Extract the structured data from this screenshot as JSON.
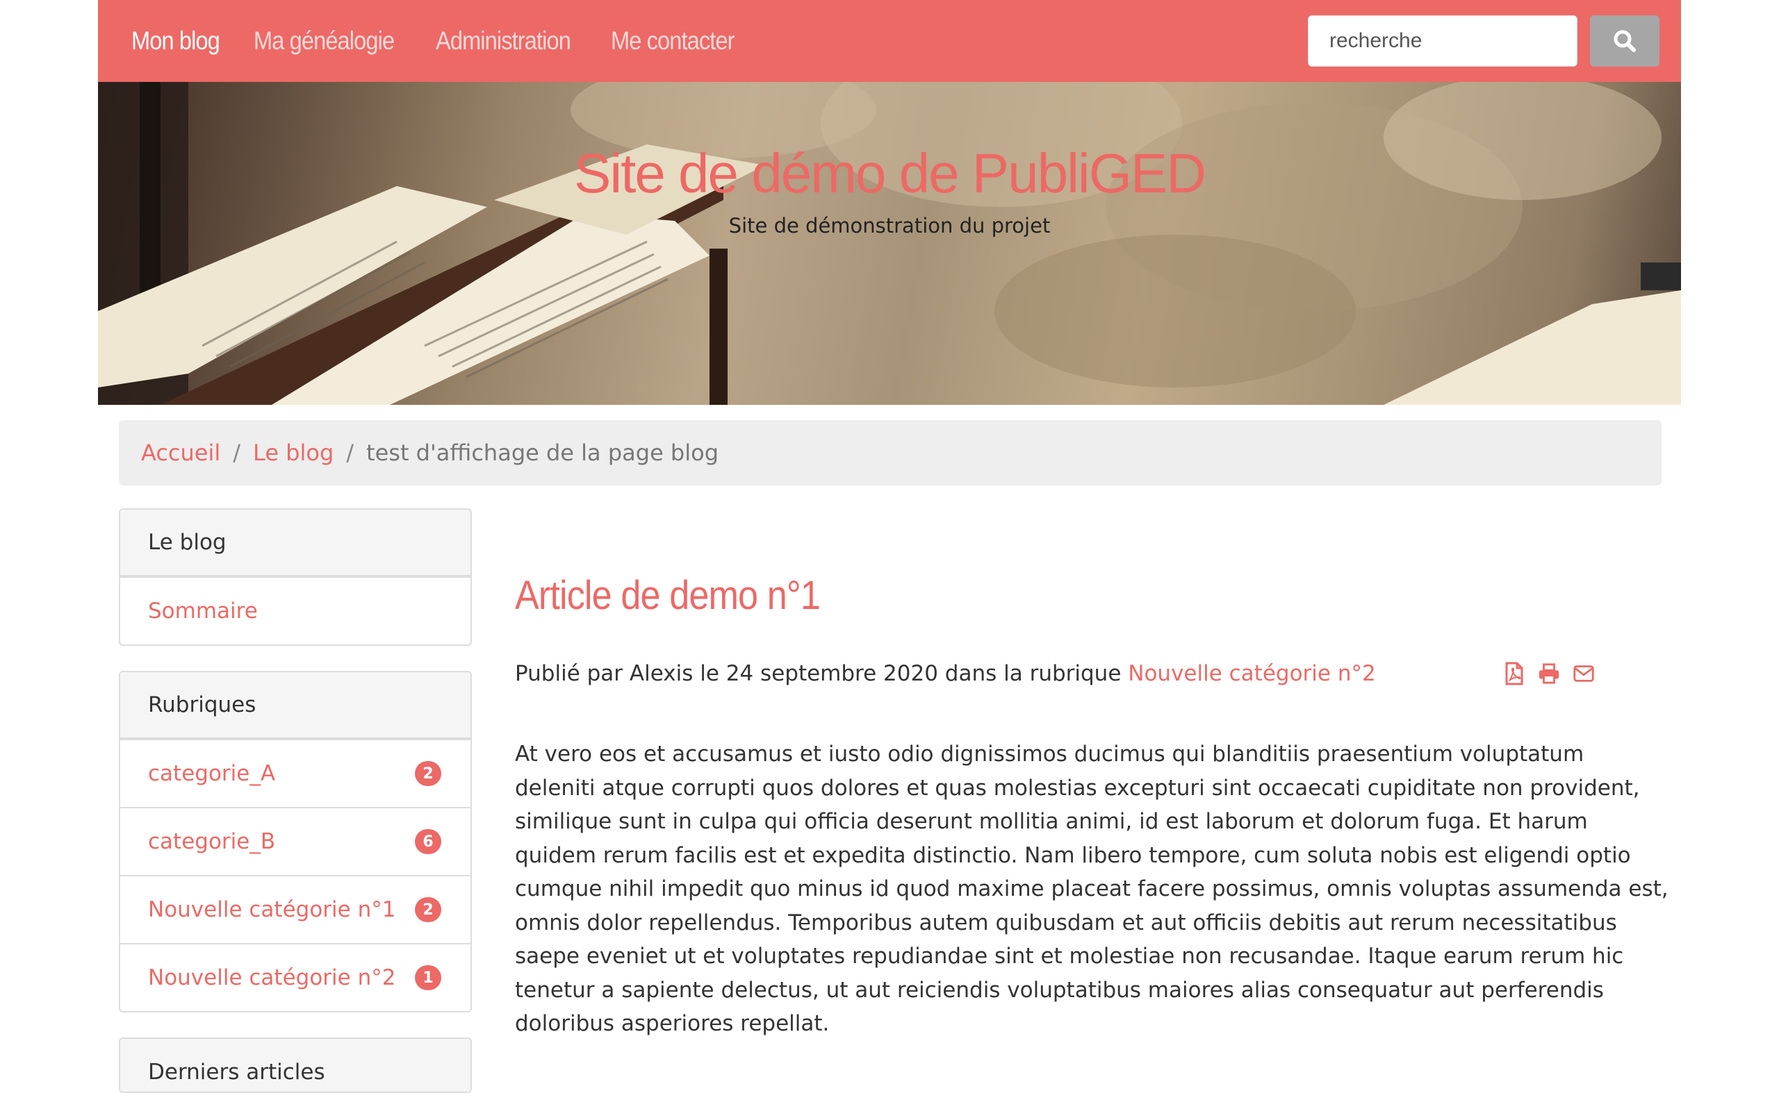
{
  "nav": {
    "items": [
      "Mon blog",
      "Ma généalogie",
      "Administration",
      "Me contacter"
    ],
    "search_placeholder": "recherche"
  },
  "hero": {
    "title": "Site de démo de PubliGED",
    "subtitle": "Site de démonstration du projet"
  },
  "breadcrumb": {
    "home": "Accueil",
    "blog": "Le blog",
    "current": "test d'affichage de la page blog",
    "separator": "/"
  },
  "sidebar": {
    "blog_panel": {
      "title": "Le blog",
      "items": [
        "Sommaire"
      ]
    },
    "categories_panel": {
      "title": "Rubriques",
      "items": [
        {
          "label": "categorie_A",
          "count": "2"
        },
        {
          "label": "categorie_B",
          "count": "6"
        },
        {
          "label": "Nouvelle catégorie n°1",
          "count": "2"
        },
        {
          "label": "Nouvelle catégorie n°2",
          "count": "1"
        }
      ]
    },
    "last_panel": {
      "title": "Derniers articles"
    }
  },
  "article": {
    "title": "Article de demo n°1",
    "meta_prefix": "Publié par Alexis le 24 septembre 2020 dans la rubrique ",
    "meta_category": "Nouvelle catégorie n°2",
    "body": "At vero eos et accusamus et iusto odio dignissimos ducimus qui blanditiis praesentium voluptatum deleniti atque corrupti quos dolores et quas molestias excepturi sint occaecati cupiditate non provident, similique sunt in culpa qui officia deserunt mollitia animi, id est laborum et dolorum fuga. Et harum quidem rerum facilis est et expedita distinctio. Nam libero tempore, cum soluta nobis est eligendi optio cumque nihil impedit quo minus id quod maxime placeat facere possimus, omnis voluptas assumenda est, omnis dolor repellendus. Temporibus autem quibusdam et aut officiis debitis aut rerum necessitatibus saepe eveniet ut et voluptates repudiandae sint et molestiae non recusandae. Itaque earum rerum hic tenetur a sapiente delectus, ut aut reiciendis voluptatibus maiores alias consequatur aut perferendis doloribus asperiores repellat.",
    "tool_icons": [
      "pdf-icon",
      "print-icon",
      "email-icon"
    ]
  },
  "colors": {
    "accent": "#ec6966",
    "search_button": "#a6a6a6",
    "breadcrumb_bg": "#eeeeee"
  }
}
